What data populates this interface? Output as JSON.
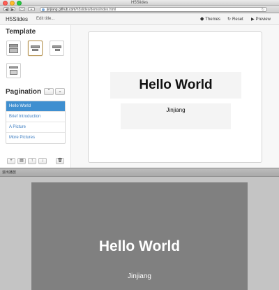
{
  "window": {
    "title": "H5Slides"
  },
  "browser": {
    "url_host": "jinjiang.github.com",
    "url_path": "/h5slides/demo/index.html",
    "back_glyph": "◀",
    "forward_glyph": "▶",
    "reader_glyph": "▭",
    "reload_glyph": "↻"
  },
  "app": {
    "logo": "H5Slides",
    "edit_title": "Edit title...",
    "themes_label": "Themes",
    "reset_label": "Reset",
    "preview_label": "Preview",
    "themes_icon": "⬣",
    "reset_icon": "↻",
    "preview_icon": "▶"
  },
  "sidebar": {
    "template_heading": "Template",
    "pagination_heading": "Pagination",
    "pagination_up": "⌃",
    "pagination_down": "⌄",
    "slides": [
      {
        "label": "Hello World",
        "active": true
      },
      {
        "label": "Brief Introduction",
        "active": false
      },
      {
        "label": "A Picture",
        "active": false
      },
      {
        "label": "More Pictures",
        "active": false
      }
    ],
    "tools": {
      "add": "+",
      "copy": "▤",
      "move_up": "↑",
      "move_down": "↓",
      "delete": "🗑"
    }
  },
  "slide": {
    "title": "Hello World",
    "subtitle": "Jinjiang"
  },
  "divider": {
    "label": "退出播放"
  },
  "preview": {
    "title": "Hello World",
    "subtitle": "Jinjiang"
  },
  "colors": {
    "accent": "#3f8fd0",
    "preview_bg": "#808080",
    "selected_template_border": "#b8985a"
  }
}
